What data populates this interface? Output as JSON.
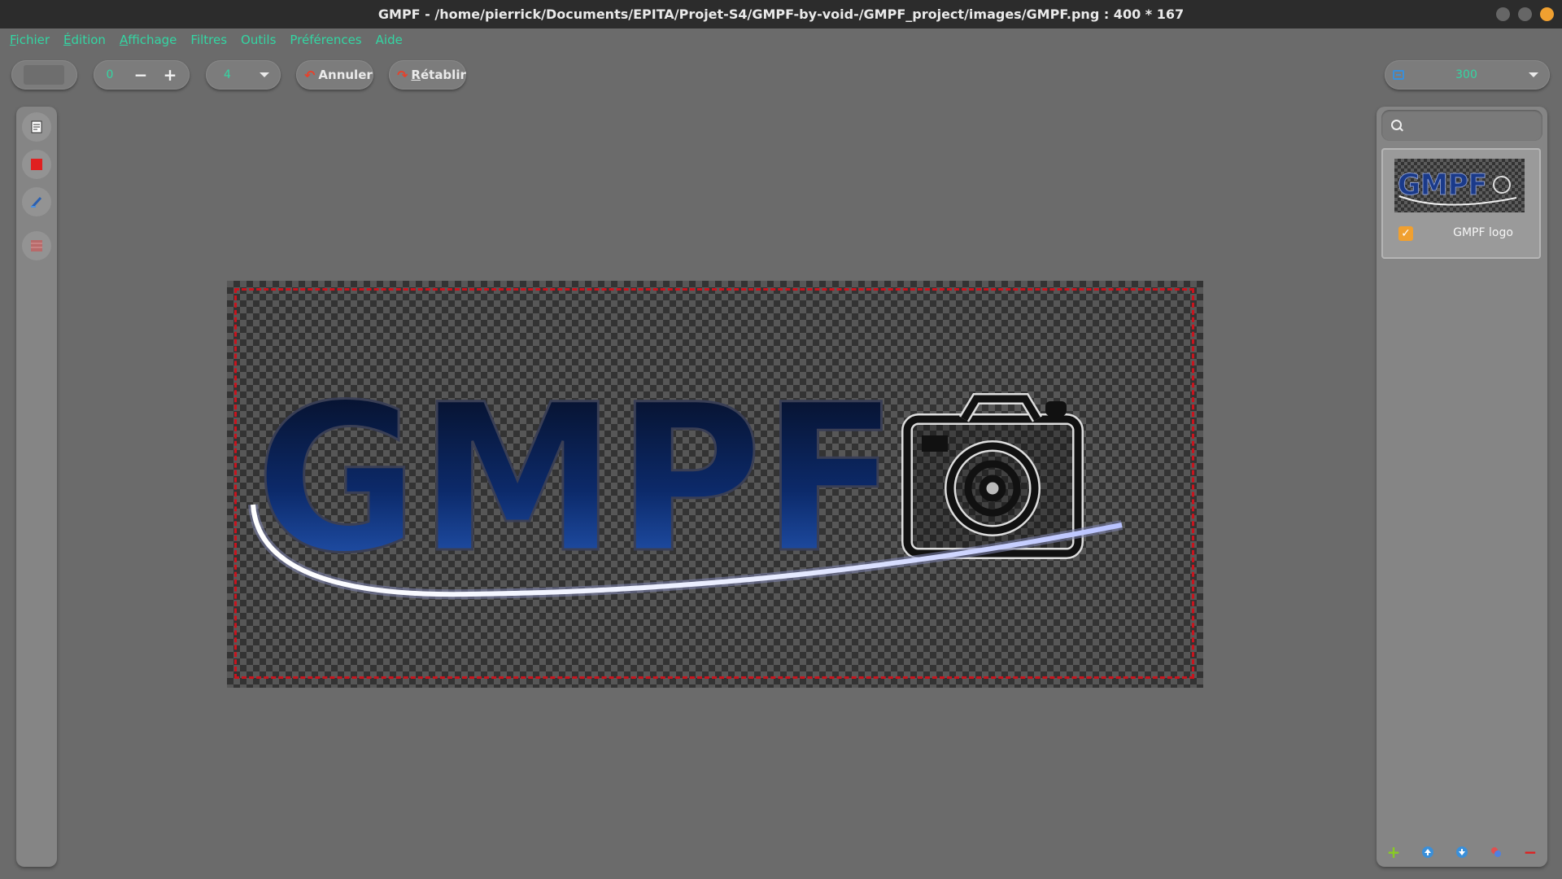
{
  "window": {
    "title": "GMPF - /home/pierrick/Documents/EPITA/Projet-S4/GMPF-by-void-/GMPF_project/images/GMPF.png : 400 * 167"
  },
  "menu": {
    "items": [
      {
        "mnemonic": "F",
        "rest": "ichier"
      },
      {
        "mnemonic": "É",
        "rest": "dition"
      },
      {
        "mnemonic": "A",
        "rest": "ffichage"
      },
      {
        "mnemonic": "",
        "rest": "Filtres"
      },
      {
        "mnemonic": "",
        "rest": "Outils"
      },
      {
        "mnemonic": "",
        "rest": "Préférences"
      },
      {
        "mnemonic": "",
        "rest": "Aide"
      }
    ]
  },
  "toolbar": {
    "size_value": "0",
    "minus_label": "−",
    "plus_label": "+",
    "brush_value": "4",
    "undo_label": "Annuler",
    "redo_mnemonic": "R",
    "redo_rest": "établir",
    "zoom_value": "300"
  },
  "canvas": {
    "logo_text": "GMPF"
  },
  "layers": {
    "items": [
      {
        "name": "GMPF logo",
        "visible": true
      }
    ]
  },
  "colors": {
    "accent": "#33d6a3",
    "selection": "#c8141e",
    "checkbox": "#f0a030"
  }
}
